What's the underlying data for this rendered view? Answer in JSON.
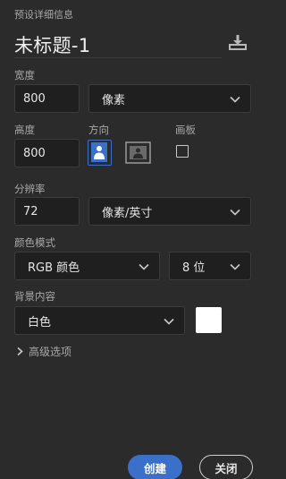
{
  "panel": {
    "section_title": "预设详细信息",
    "doc_title": "未标题-1"
  },
  "width": {
    "label": "宽度",
    "value": "800",
    "unit": "像素"
  },
  "height": {
    "label": "高度",
    "value": "800"
  },
  "orientation": {
    "label": "方向",
    "selected": "portrait"
  },
  "artboard": {
    "label": "画板",
    "checked": false
  },
  "resolution": {
    "label": "分辨率",
    "value": "72",
    "unit": "像素/英寸"
  },
  "color_mode": {
    "label": "颜色模式",
    "mode": "RGB 颜色",
    "depth": "8 位"
  },
  "background": {
    "label": "背景内容",
    "value": "白色",
    "swatch_color": "#ffffff"
  },
  "advanced": {
    "label": "高级选项"
  },
  "actions": {
    "create_label": "创建",
    "close_label": "关闭"
  },
  "colors": {
    "accent": "#3a70c7",
    "panel_bg": "#2b2b2b",
    "field_bg": "#1f1f1f"
  }
}
